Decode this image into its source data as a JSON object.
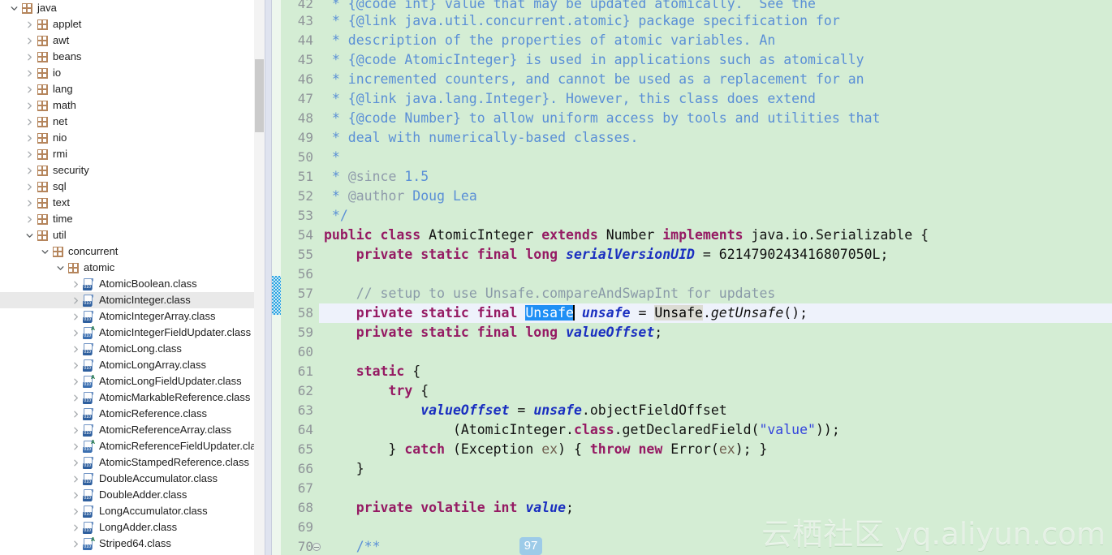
{
  "tree": {
    "scroll_thumb": true,
    "items": [
      {
        "label": "java",
        "depth": 0,
        "icon": "package-icon",
        "arrow": "expanded",
        "selected": false
      },
      {
        "label": "applet",
        "depth": 1,
        "icon": "package-icon",
        "arrow": "collapsed",
        "selected": false
      },
      {
        "label": "awt",
        "depth": 1,
        "icon": "package-icon",
        "arrow": "collapsed",
        "selected": false
      },
      {
        "label": "beans",
        "depth": 1,
        "icon": "package-icon",
        "arrow": "collapsed",
        "selected": false
      },
      {
        "label": "io",
        "depth": 1,
        "icon": "package-icon",
        "arrow": "collapsed",
        "selected": false
      },
      {
        "label": "lang",
        "depth": 1,
        "icon": "package-icon",
        "arrow": "collapsed",
        "selected": false
      },
      {
        "label": "math",
        "depth": 1,
        "icon": "package-icon",
        "arrow": "collapsed",
        "selected": false
      },
      {
        "label": "net",
        "depth": 1,
        "icon": "package-icon",
        "arrow": "collapsed",
        "selected": false
      },
      {
        "label": "nio",
        "depth": 1,
        "icon": "package-icon",
        "arrow": "collapsed",
        "selected": false
      },
      {
        "label": "rmi",
        "depth": 1,
        "icon": "package-icon",
        "arrow": "collapsed",
        "selected": false
      },
      {
        "label": "security",
        "depth": 1,
        "icon": "package-icon",
        "arrow": "collapsed",
        "selected": false
      },
      {
        "label": "sql",
        "depth": 1,
        "icon": "package-icon",
        "arrow": "collapsed",
        "selected": false
      },
      {
        "label": "text",
        "depth": 1,
        "icon": "package-icon",
        "arrow": "collapsed",
        "selected": false
      },
      {
        "label": "time",
        "depth": 1,
        "icon": "package-icon",
        "arrow": "collapsed",
        "selected": false
      },
      {
        "label": "util",
        "depth": 1,
        "icon": "package-icon",
        "arrow": "expanded",
        "selected": false
      },
      {
        "label": "concurrent",
        "depth": 2,
        "icon": "package-icon",
        "arrow": "expanded",
        "selected": false
      },
      {
        "label": "atomic",
        "depth": 3,
        "icon": "package-icon",
        "arrow": "expanded",
        "selected": false
      },
      {
        "label": "AtomicBoolean.class",
        "depth": 4,
        "icon": "class-file-icon",
        "arrow": "collapsed",
        "selected": false
      },
      {
        "label": "AtomicInteger.class",
        "depth": 4,
        "icon": "class-file-icon",
        "arrow": "collapsed",
        "selected": true
      },
      {
        "label": "AtomicIntegerArray.class",
        "depth": 4,
        "icon": "class-file-icon",
        "arrow": "collapsed",
        "selected": false
      },
      {
        "label": "AtomicIntegerFieldUpdater.class",
        "depth": 4,
        "icon": "abstract-class-file-icon",
        "arrow": "collapsed",
        "selected": false
      },
      {
        "label": "AtomicLong.class",
        "depth": 4,
        "icon": "class-file-icon",
        "arrow": "collapsed",
        "selected": false
      },
      {
        "label": "AtomicLongArray.class",
        "depth": 4,
        "icon": "class-file-icon",
        "arrow": "collapsed",
        "selected": false
      },
      {
        "label": "AtomicLongFieldUpdater.class",
        "depth": 4,
        "icon": "abstract-class-file-icon",
        "arrow": "collapsed",
        "selected": false
      },
      {
        "label": "AtomicMarkableReference.class",
        "depth": 4,
        "icon": "class-file-icon",
        "arrow": "collapsed",
        "selected": false
      },
      {
        "label": "AtomicReference.class",
        "depth": 4,
        "icon": "class-file-icon",
        "arrow": "collapsed",
        "selected": false
      },
      {
        "label": "AtomicReferenceArray.class",
        "depth": 4,
        "icon": "class-file-icon",
        "arrow": "collapsed",
        "selected": false
      },
      {
        "label": "AtomicReferenceFieldUpdater.class",
        "depth": 4,
        "icon": "abstract-class-file-icon",
        "arrow": "collapsed",
        "selected": false
      },
      {
        "label": "AtomicStampedReference.class",
        "depth": 4,
        "icon": "class-file-icon",
        "arrow": "collapsed",
        "selected": false
      },
      {
        "label": "DoubleAccumulator.class",
        "depth": 4,
        "icon": "class-file-icon",
        "arrow": "collapsed",
        "selected": false
      },
      {
        "label": "DoubleAdder.class",
        "depth": 4,
        "icon": "class-file-icon",
        "arrow": "collapsed",
        "selected": false
      },
      {
        "label": "LongAccumulator.class",
        "depth": 4,
        "icon": "class-file-icon",
        "arrow": "collapsed",
        "selected": false
      },
      {
        "label": "LongAdder.class",
        "depth": 4,
        "icon": "class-file-icon",
        "arrow": "collapsed",
        "selected": false
      },
      {
        "label": "Striped64.class",
        "depth": 4,
        "icon": "abstract-class-file-icon",
        "arrow": "collapsed",
        "selected": false
      }
    ]
  },
  "editor": {
    "first_visible_line": 42,
    "current_line": 58,
    "selection_text": "Unsafe",
    "inline_badge": "97",
    "changed_lines_marker": {
      "from": 57,
      "to": 58
    },
    "folded_marker_line": 70,
    "colors": {
      "background": "#d4edd4",
      "current_line": "#eef2fb",
      "selection": "#1f8ff5",
      "keyword": "#951a63",
      "comment": "#5a8fd6",
      "field": "#1a2fc0",
      "string": "#3344dd",
      "line_number": "#8f9499",
      "change_marker": "#2aa3e0"
    },
    "lines": [
      {
        "n": "42",
        "clipped": true,
        "tokens": [
          {
            "t": " * {@code int} value that may be updated atomically.  See the",
            "c": "cmt"
          }
        ]
      },
      {
        "n": "43",
        "tokens": [
          {
            "t": " * ",
            "c": "cmt"
          },
          {
            "t": "{@link java.util.concurrent.atomic}",
            "c": "cmt"
          },
          {
            "t": " package specification for",
            "c": "cmt"
          }
        ]
      },
      {
        "n": "44",
        "tokens": [
          {
            "t": " * description of the properties of atomic variables. An",
            "c": "cmt"
          }
        ]
      },
      {
        "n": "45",
        "tokens": [
          {
            "t": " * {@code AtomicInteger} is used in applications such as atomically",
            "c": "cmt"
          }
        ]
      },
      {
        "n": "46",
        "tokens": [
          {
            "t": " * incremented counters, and cannot be used as a replacement for an",
            "c": "cmt"
          }
        ]
      },
      {
        "n": "47",
        "tokens": [
          {
            "t": " * {@link java.lang.Integer}. However, this class does extend",
            "c": "cmt"
          }
        ]
      },
      {
        "n": "48",
        "tokens": [
          {
            "t": " * {@code Number} to allow uniform access by tools and utilities that",
            "c": "cmt"
          }
        ]
      },
      {
        "n": "49",
        "tokens": [
          {
            "t": " * deal with numerically-based classes.",
            "c": "cmt"
          }
        ]
      },
      {
        "n": "50",
        "tokens": [
          {
            "t": " *",
            "c": "cmt"
          }
        ]
      },
      {
        "n": "51",
        "tokens": [
          {
            "t": " * ",
            "c": "cmt"
          },
          {
            "t": "@since",
            "c": "tag"
          },
          {
            "t": " 1.5",
            "c": "cmt"
          }
        ]
      },
      {
        "n": "52",
        "tokens": [
          {
            "t": " * ",
            "c": "cmt"
          },
          {
            "t": "@author",
            "c": "tag"
          },
          {
            "t": " Doug Lea",
            "c": "cmt"
          }
        ]
      },
      {
        "n": "53",
        "tokens": [
          {
            "t": " */",
            "c": "cmt"
          }
        ]
      },
      {
        "n": "54",
        "tokens": [
          {
            "t": "public class ",
            "c": "kw"
          },
          {
            "t": "AtomicInteger ",
            "c": "plain"
          },
          {
            "t": "extends ",
            "c": "kw"
          },
          {
            "t": "Number ",
            "c": "plain"
          },
          {
            "t": "implements ",
            "c": "kw"
          },
          {
            "t": "java.io.Serializable {",
            "c": "plain"
          }
        ]
      },
      {
        "n": "55",
        "tokens": [
          {
            "t": "    private static final long ",
            "c": "kw"
          },
          {
            "t": "serialVersionUID",
            "c": "fld"
          },
          {
            "t": " = ",
            "c": "plain"
          },
          {
            "t": "6214790243416807050L",
            "c": "num"
          },
          {
            "t": ";",
            "c": "plain"
          }
        ]
      },
      {
        "n": "56",
        "tokens": []
      },
      {
        "n": "57",
        "tokens": [
          {
            "t": "    ",
            "c": "plain"
          },
          {
            "t": "// setup to use Unsafe.compareAndSwapInt for updates",
            "c": "cmt2"
          }
        ]
      },
      {
        "n": "58",
        "tokens": [
          {
            "t": "    private static final ",
            "c": "kw"
          },
          {
            "t": "Unsafe",
            "c": "sel"
          },
          {
            "t": "|CARET|",
            "c": "caret"
          },
          {
            "t": " ",
            "c": "plain"
          },
          {
            "t": "unsafe",
            "c": "fld"
          },
          {
            "t": " = ",
            "c": "plain"
          },
          {
            "t": "Unsafe",
            "c": "occ"
          },
          {
            "t": ".",
            "c": "plain"
          },
          {
            "t": "getUnsafe",
            "c": "mth"
          },
          {
            "t": "();",
            "c": "plain"
          }
        ]
      },
      {
        "n": "59",
        "tokens": [
          {
            "t": "    private static final long ",
            "c": "kw"
          },
          {
            "t": "valueOffset",
            "c": "fld"
          },
          {
            "t": ";",
            "c": "plain"
          }
        ]
      },
      {
        "n": "60",
        "tokens": []
      },
      {
        "n": "61",
        "tokens": [
          {
            "t": "    static ",
            "c": "kw"
          },
          {
            "t": "{",
            "c": "plain"
          }
        ]
      },
      {
        "n": "62",
        "tokens": [
          {
            "t": "        try ",
            "c": "kw"
          },
          {
            "t": "{",
            "c": "plain"
          }
        ]
      },
      {
        "n": "63",
        "tokens": [
          {
            "t": "            ",
            "c": "plain"
          },
          {
            "t": "valueOffset",
            "c": "fld"
          },
          {
            "t": " = ",
            "c": "plain"
          },
          {
            "t": "unsafe",
            "c": "fld"
          },
          {
            "t": ".objectFieldOffset",
            "c": "plain"
          }
        ]
      },
      {
        "n": "64",
        "tokens": [
          {
            "t": "                (AtomicInteger.",
            "c": "plain"
          },
          {
            "t": "class",
            "c": "kw"
          },
          {
            "t": ".getDeclaredField(",
            "c": "plain"
          },
          {
            "t": "\"value\"",
            "c": "str"
          },
          {
            "t": "));",
            "c": "plain"
          }
        ]
      },
      {
        "n": "65",
        "tokens": [
          {
            "t": "        } ",
            "c": "plain"
          },
          {
            "t": "catch ",
            "c": "kw"
          },
          {
            "t": "(Exception ",
            "c": "plain"
          },
          {
            "t": "ex",
            "c": "par"
          },
          {
            "t": ") { ",
            "c": "plain"
          },
          {
            "t": "throw new ",
            "c": "kw"
          },
          {
            "t": "Error(",
            "c": "plain"
          },
          {
            "t": "ex",
            "c": "par"
          },
          {
            "t": "); }",
            "c": "plain"
          }
        ]
      },
      {
        "n": "66",
        "tokens": [
          {
            "t": "    }",
            "c": "plain"
          }
        ]
      },
      {
        "n": "67",
        "tokens": []
      },
      {
        "n": "68",
        "tokens": [
          {
            "t": "    private volatile int ",
            "c": "kw"
          },
          {
            "t": "value",
            "c": "fld"
          },
          {
            "t": ";",
            "c": "plain"
          }
        ]
      },
      {
        "n": "69",
        "tokens": []
      },
      {
        "n": "70",
        "fold": true,
        "tokens": [
          {
            "t": "    ",
            "c": "plain"
          },
          {
            "t": "/**",
            "c": "cmt"
          }
        ]
      }
    ]
  },
  "watermark": {
    "cn": "云栖社区",
    "domain": "yq.aliyun.com"
  }
}
